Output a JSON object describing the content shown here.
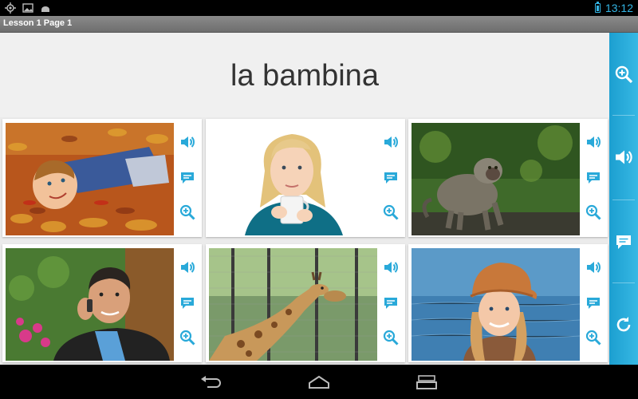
{
  "status_bar": {
    "icons": [
      "gps-icon",
      "picture-icon",
      "android-icon"
    ],
    "battery_icon": "battery-charging-icon",
    "time": "13:12"
  },
  "title_bar": {
    "title": "Lesson 1 Page 1"
  },
  "main": {
    "word": "la bambina",
    "cards": [
      {
        "subject": "boy lying in autumn leaves"
      },
      {
        "subject": "blonde woman holding a mug"
      },
      {
        "subject": "monkey on the ground"
      },
      {
        "subject": "man talking on a mobile phone"
      },
      {
        "subject": "giraffe behind a fence"
      },
      {
        "subject": "girl wearing an orange cap"
      }
    ],
    "card_action_icons": [
      "speaker-icon",
      "speech-bubble-icon",
      "zoom-in-icon"
    ]
  },
  "side_panel": {
    "buttons": [
      "zoom-in-icon",
      "speaker-icon",
      "speech-bubble-icon",
      "refresh-icon"
    ]
  },
  "nav_bar": {
    "buttons": [
      "back-icon",
      "home-icon",
      "recent-apps-icon"
    ]
  },
  "colors": {
    "accent": "#2cb1e1",
    "icon_blue": "#29a9d9",
    "status_blue": "#33b5e5",
    "header_bg": "#f0f0f0",
    "titlebar": "#7a7a7a"
  }
}
